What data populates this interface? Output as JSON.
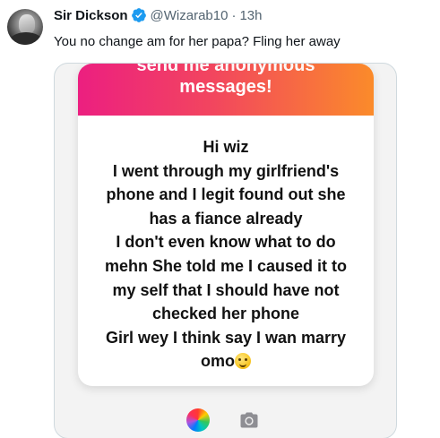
{
  "author": {
    "name": "Sir Dickson",
    "handle": "@Wizarab10",
    "separator": "·",
    "time": "13h",
    "verified": true
  },
  "tweet": {
    "text": "You no change am for her papa? Fling her away"
  },
  "media": {
    "banner_line1": "send me anonymous",
    "banner_line2": "messages!",
    "banner_colors": [
      "#ec1f80",
      "#f2455f",
      "#fb8b2a"
    ],
    "message_lines": [
      "Hi wiz",
      "I went through my girlfriend's",
      "phone and I legit found out she",
      "has a fiance already",
      "I don't even know what to do",
      "mehn She told me I caused it to",
      "my self that I should have not",
      "checked her phone",
      "Girl wey  I think say I wan  marry",
      "omo"
    ],
    "message_emoji": "slightly-smiling-face-icon",
    "controls": [
      "color-wheel-icon",
      "camera-icon"
    ]
  },
  "colors": {
    "verified_badge": "#1d9bf0",
    "secondary_text": "#536471"
  }
}
